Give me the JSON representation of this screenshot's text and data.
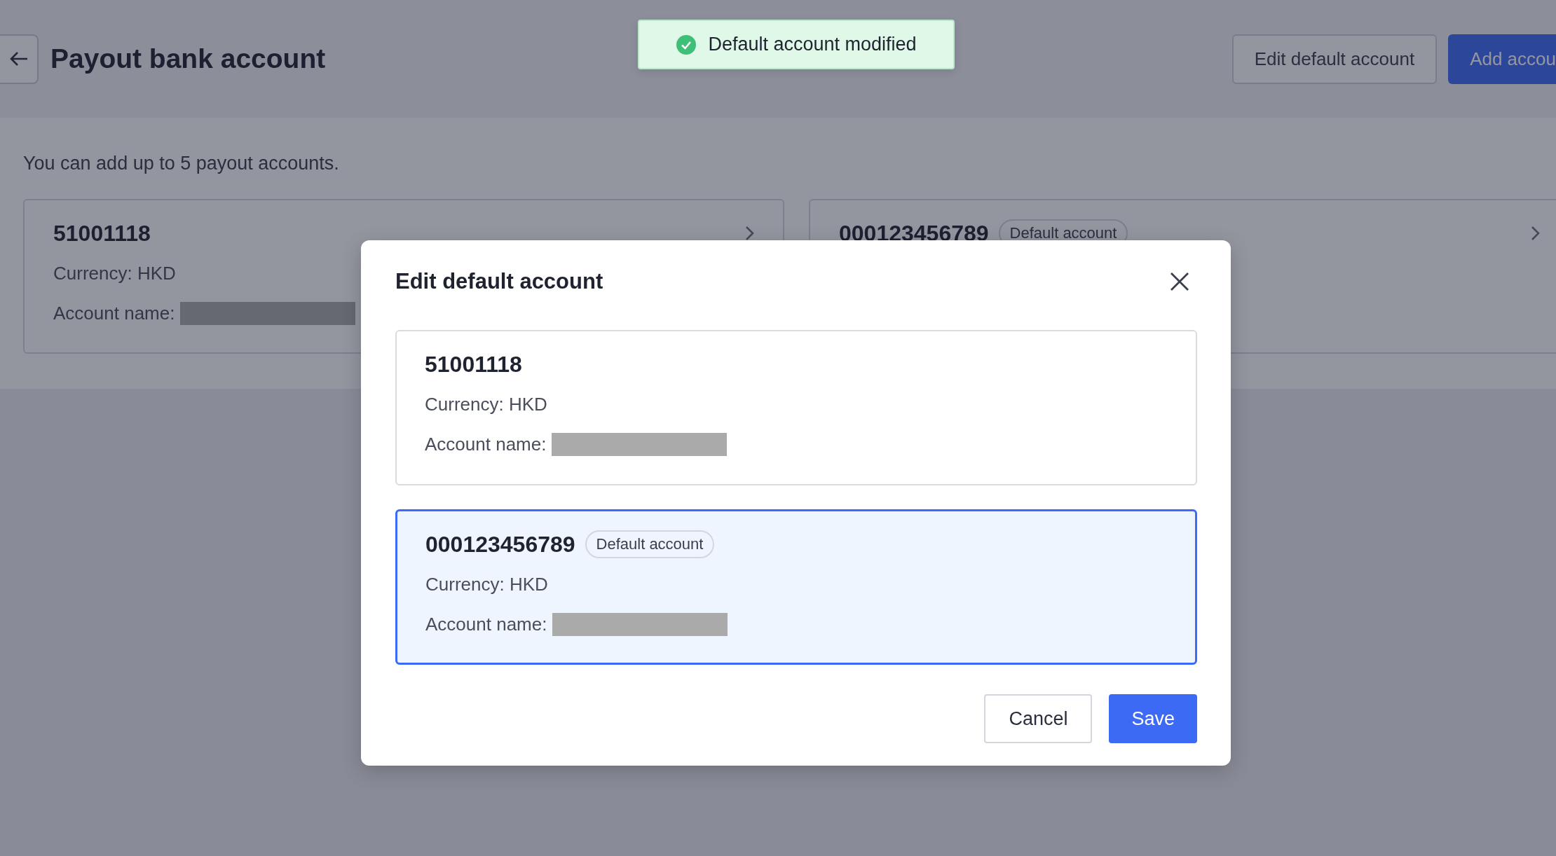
{
  "header": {
    "title": "Payout bank account",
    "buttons": [
      {
        "label": "Edit default account",
        "kind": "secondary"
      },
      {
        "label": "Add accou",
        "kind": "primary"
      }
    ]
  },
  "toast": {
    "kind": "success",
    "message": "Default account modified"
  },
  "notice": "You can add up to 5 payout accounts.",
  "accounts": [
    {
      "number": "51001118",
      "currency": "Currency: HKD",
      "name_label": "Account name:",
      "name_masked": true
    },
    {
      "number": "000123456789",
      "badge": "Default account"
    }
  ],
  "modal": {
    "title": "Edit default account",
    "options": [
      {
        "number": "51001118",
        "currency": "Currency: HKD",
        "name_label": "Account name:",
        "name_masked": true,
        "selected": false
      },
      {
        "number": "000123456789",
        "badge": "Default account",
        "currency": "Currency: HKD",
        "name_label": "Account name:",
        "name_masked": true,
        "selected": true
      }
    ],
    "buttons": [
      {
        "label": "Cancel",
        "kind": "secondary"
      },
      {
        "label": "Save",
        "kind": "primary"
      }
    ]
  }
}
